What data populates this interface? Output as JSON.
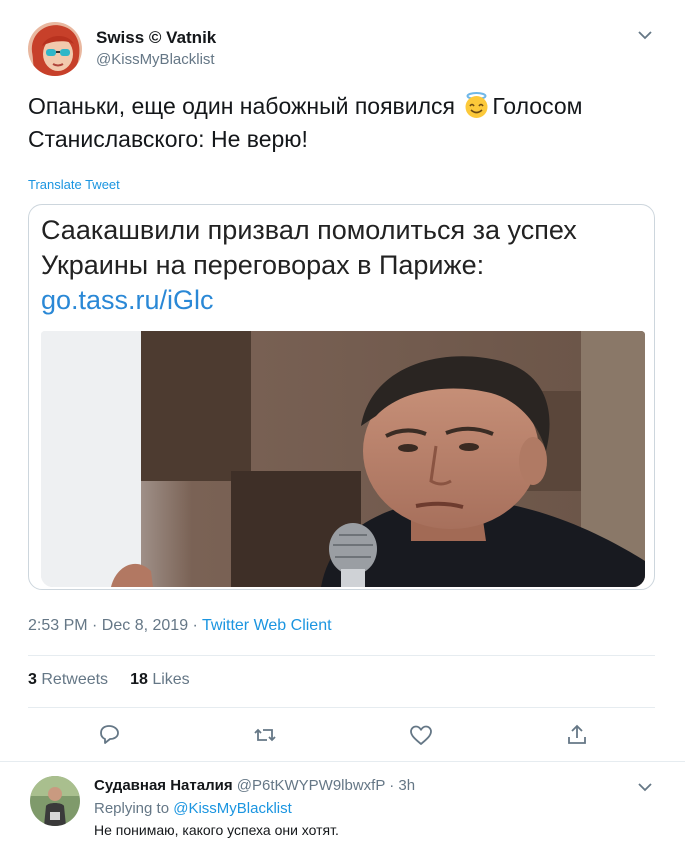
{
  "tweet": {
    "author_name": "Swiss © Vatnik",
    "author_handle": "@KissMyBlacklist",
    "text_part1": "Опаньки, еще один набожный появился ",
    "text_part2": "Голосом Станиславского: Не верю!",
    "emoji_icon": "smiling-face-with-halo-icon",
    "translate_label": "Translate Tweet",
    "card": {
      "headline": "Саакашвили призвал помолиться за успех Украины на переговорах в Париже:",
      "link": "go.tass.ru/iGlc"
    },
    "time": "2:53 PM · Dec 8, 2019 · ",
    "client": "Twitter Web Client",
    "retweets_count": "3",
    "retweets_label": "Retweets",
    "likes_count": "18",
    "likes_label": "Likes"
  },
  "actions": [
    {
      "icon": "reply-icon"
    },
    {
      "icon": "retweet-icon"
    },
    {
      "icon": "like-icon"
    },
    {
      "icon": "share-icon"
    }
  ],
  "reply": {
    "author_name": "Судавная Наталия",
    "author_handle": "@P6tKWYPW9lbwxfP · 3h",
    "replying_prefix": "Replying to ",
    "replying_mention": "@KissMyBlacklist",
    "text": "Не понимаю, какого успеха они хотят."
  },
  "colors": {
    "link_blue": "#1b95e0",
    "muted_gray": "#657786",
    "border": "#e6ecf0"
  }
}
